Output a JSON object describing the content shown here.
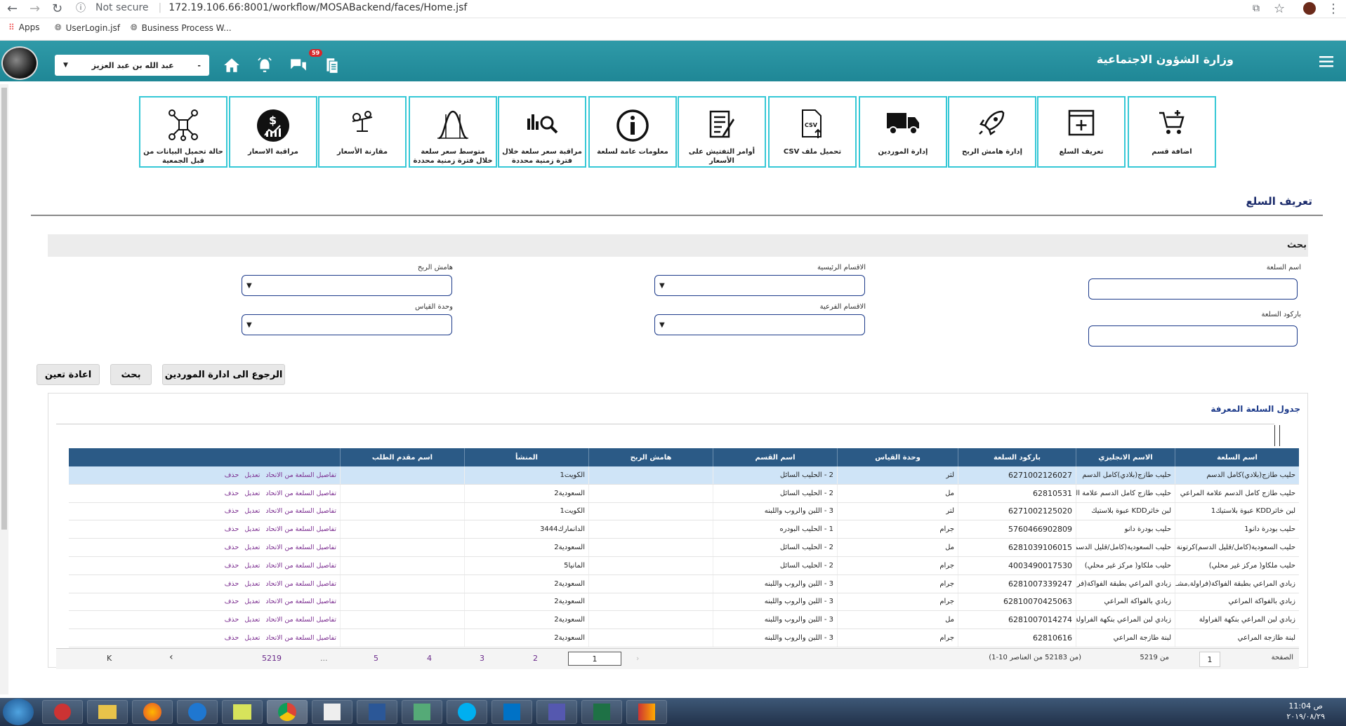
{
  "browser": {
    "security": "Not secure",
    "url": "172.19.106.66:8001/workflow/MOSABackend/faces/Home.jsf",
    "bookmarks": [
      "Apps",
      "UserLogin.jsf",
      "Business Process W..."
    ]
  },
  "header": {
    "app_title": "وزارة الشؤون الاجتماعية",
    "user_name": "عبد الله بن عبد العزيز",
    "user_prefix": "-",
    "notification_count": "59"
  },
  "tiles": [
    {
      "label": "اضافة قسم",
      "icon": "add-to-cart-icon"
    },
    {
      "label": "تعريف السلع",
      "icon": "add-window-icon"
    },
    {
      "label": "إدارة هامش الربح",
      "icon": "rocket-icon"
    },
    {
      "label": "إدارة الموردين",
      "icon": "truck-icon"
    },
    {
      "label": "تحميل ملف CSV",
      "icon": "csv-file-icon"
    },
    {
      "label": "أوامر التفتيش على الأسعار",
      "icon": "checklist-icon"
    },
    {
      "label": "معلومات عامة لسلعة",
      "icon": "info-icon"
    },
    {
      "label": "مراقبة سعر سلعة خلال فترة زمنية محددة",
      "icon": "bar-chart-search-icon"
    },
    {
      "label": "متوسط سعر سلعة خلال فترة زمنية محددة",
      "icon": "bell-curve-icon"
    },
    {
      "label": "مقارنة الأسعار",
      "icon": "scale-icon"
    },
    {
      "label": "مراقبة الاسعار",
      "icon": "dollar-chart-icon"
    },
    {
      "label": "حالة تحميل البيانات من قبل الجمعية",
      "icon": "network-icon"
    }
  ],
  "page": {
    "title": "تعريف السلع"
  },
  "search": {
    "title": "بحث",
    "labels": {
      "product_name": "اسم السلعة",
      "barcode": "باركود السلعة",
      "main_sections": "الاقسام الرئيسية",
      "sub_sections": "الاقسام الفرعية",
      "profit_margin": "هامش الربح",
      "unit": "وحدة القياس"
    },
    "buttons": {
      "back": "الرجوع الى ادارة الموردين",
      "search": "بحث",
      "reset": "اعادة تعين"
    }
  },
  "table": {
    "caption": "جدول السلعة المعرفة",
    "columns": [
      "اسم السلعة",
      "الاسم الانجليزي",
      "باركود السلعة",
      "وحدة القياس",
      "اسم القسم",
      "هامش الربح",
      "المنشأ",
      "اسم مقدم الطلب"
    ],
    "actions": [
      "تفاصيل السلعة من الاتحاد",
      "تعديل",
      "حذف"
    ],
    "rows": [
      [
        "حليب طازج(بلادي)كامل الدسم",
        "حليب طازج(بلادي)كامل الدسم",
        "6271002126027",
        "لتر",
        "2 - الحليب السائل",
        "",
        "الكويت1",
        ""
      ],
      [
        "حليب طازج كامل الدسم علامة المراعي",
        "حليب طازج كامل الدسم علامة المراعي",
        "62810531",
        "مل",
        "2 - الحليب السائل",
        "",
        "السعودية2",
        ""
      ],
      [
        "لبن خاثرKDD عبوة بلاستيك1",
        "لبن خاثرKDD عبوة بلاستيك",
        "6271002125020",
        "لتر",
        "3 - اللبن والروب واللبنه",
        "",
        "الكويت1",
        ""
      ],
      [
        "حليب بودرة دانو1",
        "حليب بودرة دانو",
        "5760466902809",
        "جرام",
        "1 - الحليب البودره",
        "",
        "الدانمارك3444",
        ""
      ],
      [
        "حليب السعودية(كامل/قليل الدسم)كرتونة",
        "حليب السعودية(كامل/قليل الدسم)كرتونة",
        "6281039106015",
        "مل",
        "2 - الحليب السائل",
        "",
        "السعودية2",
        ""
      ],
      [
        "حليب ملكاو( مركز غير محلي)",
        "حليب ملكاو( مركز غير محلي)",
        "4003490017530",
        "جرام",
        "2 - الحليب السائل",
        "",
        "المانيا5",
        ""
      ],
      [
        "زبادي المراعي بطبقة الفواكة(فراولة,مشـ ...",
        "زبادي المراعي بطبقة الفواكة(فراولة,مشـ ...",
        "6281007339247",
        "جرام",
        "3 - اللبن والروب واللبنه",
        "",
        "السعودية2",
        ""
      ],
      [
        "زبادي بالفواكة المراعي",
        "زبادي بالفواكة المراعي",
        "62810070425063",
        "جرام",
        "3 - اللبن والروب واللبنه",
        "",
        "السعودية2",
        ""
      ],
      [
        "زبادي لبن المراعي بنكهة الفراولة",
        "زبادي لبن المراعي بنكهة الفراولة",
        "6281007014274",
        "مل",
        "3 - اللبن والروب واللبنه",
        "",
        "السعودية2",
        ""
      ],
      [
        "لبنة طازجة المراعي",
        "لبنة طازجة المراعي",
        "62810616",
        "جرام",
        "3 - اللبن والروب واللبنه",
        "",
        "السعودية2",
        ""
      ]
    ]
  },
  "pager": {
    "label": "الصفحة",
    "current": "1",
    "of_pages": "من 5219",
    "summary": "(1-10 من 52183 من العناصر)",
    "pages": [
      "2",
      "3",
      "4",
      "5",
      "...",
      "5219"
    ],
    "first": "K",
    "prev": "‹",
    "next": "›",
    "last": "⟩|"
  },
  "taskbar": {
    "time": "11:04 ص",
    "date": "٢٠١٩/٠٨/٢٩"
  }
}
